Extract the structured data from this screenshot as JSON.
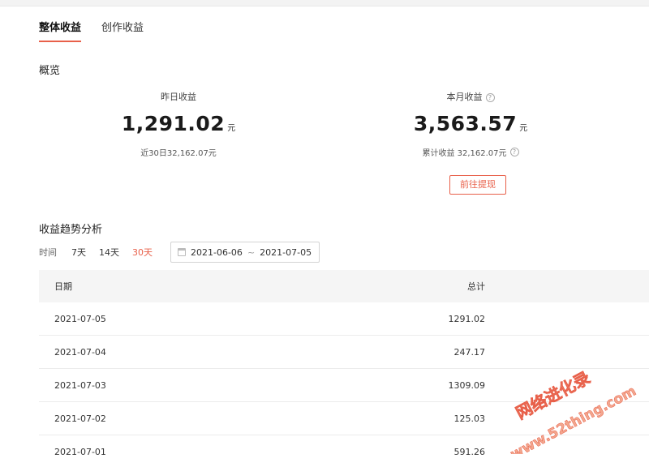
{
  "tabs": [
    {
      "label": "整体收益",
      "active": true
    },
    {
      "label": "创作收益",
      "active": false
    }
  ],
  "overview": {
    "title": "概览",
    "yesterday": {
      "label": "昨日收益",
      "value": "1,291.02",
      "unit": "元",
      "sub": "近30日32,162.07元"
    },
    "month": {
      "label": "本月收益",
      "value": "3,563.57",
      "unit": "元",
      "sub": "累计收益 32,162.07元"
    },
    "withdraw_label": "前往提现"
  },
  "trend": {
    "title": "收益趋势分析",
    "time_label": "时间",
    "ranges": [
      {
        "label": "7天",
        "active": false
      },
      {
        "label": "14天",
        "active": false
      },
      {
        "label": "30天",
        "active": true
      }
    ],
    "date_start": "2021-06-06",
    "date_sep": "~",
    "date_end": "2021-07-05"
  },
  "table": {
    "headers": {
      "date": "日期",
      "total": "总计"
    },
    "rows": [
      {
        "date": "2021-07-05",
        "total": "1291.02"
      },
      {
        "date": "2021-07-04",
        "total": "247.17"
      },
      {
        "date": "2021-07-03",
        "total": "1309.09"
      },
      {
        "date": "2021-07-02",
        "total": "125.03"
      },
      {
        "date": "2021-07-01",
        "total": "591.26"
      }
    ]
  },
  "watermark": {
    "line1": "网络进化录",
    "line2": "www.52thing.com"
  },
  "colors": {
    "accent": "#e8604a",
    "header_bg": "#f5f5f5",
    "watermark": "#f08a6c"
  }
}
